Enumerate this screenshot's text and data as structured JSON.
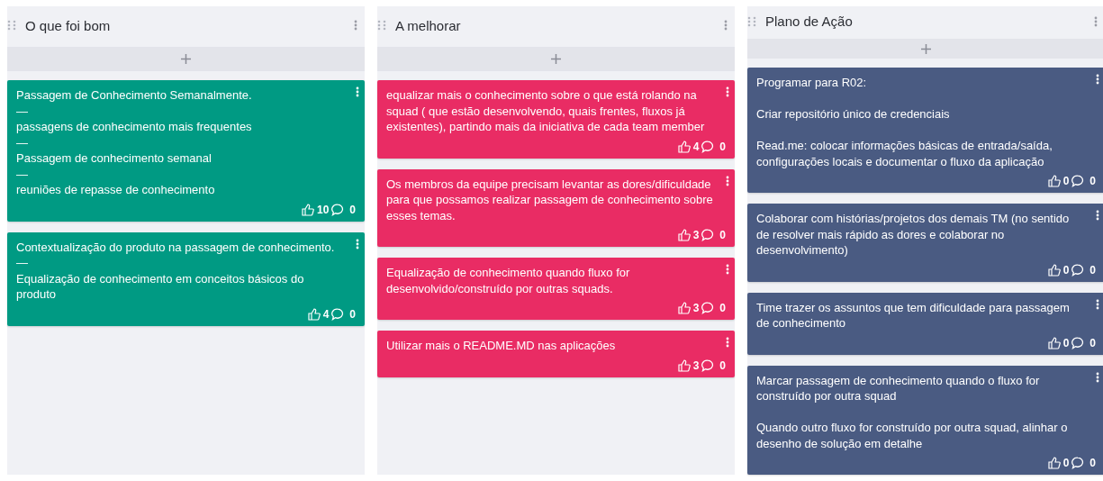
{
  "columns": [
    {
      "title": "O que foi bom",
      "color": "#009a83",
      "cards": [
        {
          "text": "Passagem de Conhecimento Semanalmente.\n—\npassagens de conhecimento mais frequentes\n—\nPassagem de conhecimento semanal\n—\nreuniões de repasse de conhecimento",
          "likes": "10",
          "comments": "0"
        },
        {
          "text": "Contextualização do produto na passagem de conhecimento.\n—\nEqualização de conhecimento em conceitos básicos do produto",
          "likes": "4",
          "comments": "0"
        }
      ]
    },
    {
      "title": "A melhorar",
      "color": "#e92c64",
      "cards": [
        {
          "text": "equalizar mais o conhecimento sobre o que está rolando na squad ( que estão desenvolvendo, quais frentes, fluxos já existentes), partindo mais da iniciativa de cada team member",
          "likes": "4",
          "comments": "0"
        },
        {
          "text": "Os membros da equipe precisam levantar as dores/dificuldade para que possamos realizar passagem de conhecimento sobre esses temas.",
          "likes": "3",
          "comments": "0"
        },
        {
          "text": "Equalização de conhecimento quando fluxo for desenvolvido/construído por outras squads.",
          "likes": "3",
          "comments": "0"
        },
        {
          "text": "Utilizar mais o README.MD nas aplicações",
          "likes": "3",
          "comments": "0"
        }
      ]
    },
    {
      "title": "Plano de Ação",
      "color": "#4a5b82",
      "cards": [
        {
          "text": "Programar para R02:\n\nCriar repositório único de credenciais\n\nRead.me: colocar informações básicas de entrada/saída, configurações locais e documentar o fluxo da aplicação",
          "likes": "0",
          "comments": "0"
        },
        {
          "text": "Colaborar com histórias/projetos dos demais TM (no sentido de resolver mais rápido as dores e colaborar no desenvolvimento)",
          "likes": "0",
          "comments": "0"
        },
        {
          "text": "Time trazer os assuntos que tem dificuldade para passagem de conhecimento",
          "likes": "0",
          "comments": "0"
        },
        {
          "text": "Marcar passagem de conhecimento quando o fluxo for construído por outra squad\n\nQuando outro fluxo for construído por outra squad, alinhar o desenho de solução em detalhe",
          "likes": "0",
          "comments": "0"
        }
      ]
    }
  ]
}
